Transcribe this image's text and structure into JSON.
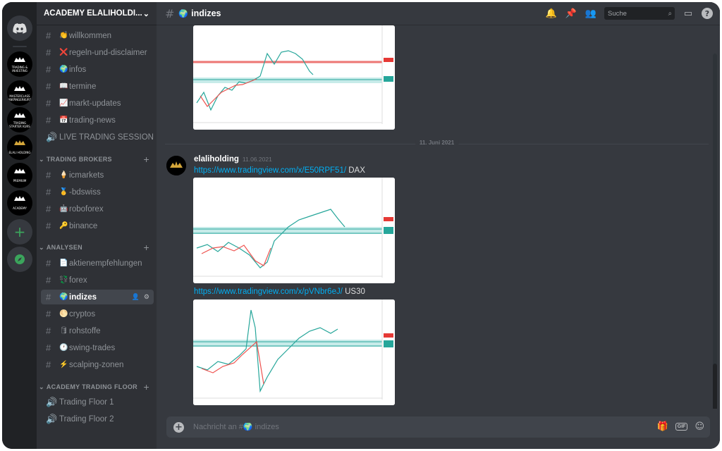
{
  "server": {
    "name": "ACADEMY ELALIHOLDI..."
  },
  "guilds": [
    {
      "label": "TRADING & INVESTING"
    },
    {
      "label": "MASTERCLASS ANFÄNGERKURS"
    },
    {
      "label": "TRADING STARTER KURS"
    },
    {
      "label": "ELALI HOLDING"
    },
    {
      "label": "PREMIUM"
    },
    {
      "label": "ACADEMY"
    }
  ],
  "channels_top": [
    {
      "emoji": "👏",
      "name": "willkommen"
    },
    {
      "emoji": "❌",
      "name": "regeln-und-disclaimer"
    },
    {
      "emoji": "🌍",
      "name": "infos"
    },
    {
      "emoji": "📖",
      "name": "termine"
    },
    {
      "emoji": "📈",
      "name": "markt-updates"
    },
    {
      "emoji": "📅",
      "name": "trading-news"
    },
    {
      "emoji": "",
      "name": "LIVE TRADING SESSION"
    }
  ],
  "categories": [
    {
      "name": "TRADING BROKERS",
      "channels": [
        {
          "emoji": "🍦",
          "name": "icmarkets"
        },
        {
          "emoji": "🥇",
          "name": "-bdswiss"
        },
        {
          "emoji": "🤖",
          "name": "roboforex"
        },
        {
          "emoji": "🔑",
          "name": "binance"
        }
      ]
    },
    {
      "name": "ANALYSEN",
      "channels": [
        {
          "emoji": "📄",
          "name": "aktienempfehlungen"
        },
        {
          "emoji": "💱",
          "name": "forex"
        },
        {
          "emoji": "🌍",
          "name": "indizes"
        },
        {
          "emoji": "🌕",
          "name": "cryptos"
        },
        {
          "emoji": "🛢",
          "name": "rohstoffe"
        },
        {
          "emoji": "🕐",
          "name": "swing-trades"
        },
        {
          "emoji": "⚡",
          "name": "scalping-zonen"
        }
      ]
    },
    {
      "name": "ACADEMY TRADING FLOOR",
      "channels": [
        {
          "emoji": "",
          "name": "Trading Floor 1"
        },
        {
          "emoji": "",
          "name": "Trading Floor 2"
        }
      ]
    }
  ],
  "channel": {
    "emoji": "🌍",
    "name": "indizes"
  },
  "search": {
    "placeholder": "Suche"
  },
  "date_divider": "11. Juni 2021",
  "message": {
    "author": "elaliholding",
    "timestamp": "11.06.2021",
    "link1": "https://www.tradingview.com/x/E50RPF51/",
    "text1": " DAX",
    "link2": "https://www.tradingview.com/x/pVNbr6eJ/",
    "text2": " US30"
  },
  "composer": {
    "placeholder": "Nachricht an #🌍 indizes"
  },
  "colors": {
    "accent": "#5865f2",
    "link": "#00aff4",
    "green": "#3ba55c"
  }
}
